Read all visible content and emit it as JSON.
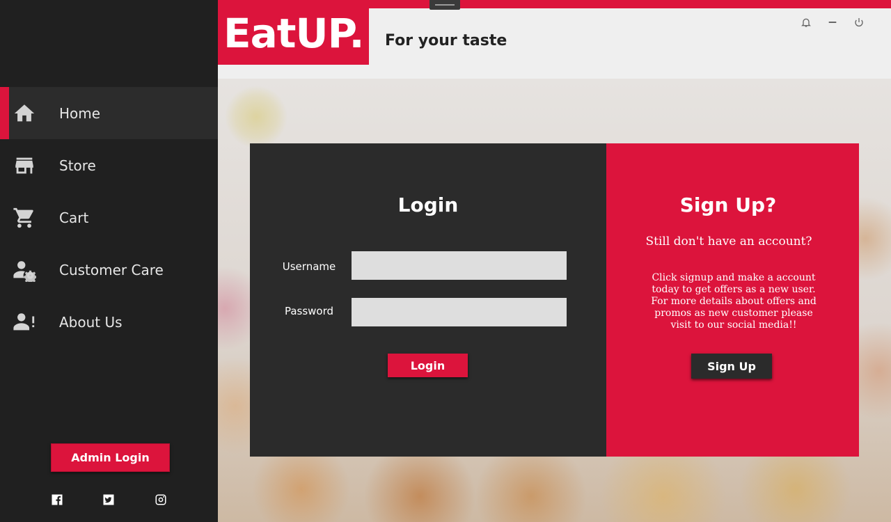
{
  "sidebar": {
    "items": [
      {
        "label": "Home",
        "icon": "home-icon",
        "active": true
      },
      {
        "label": "Store",
        "icon": "store-icon",
        "active": false
      },
      {
        "label": "Cart",
        "icon": "cart-icon",
        "active": false
      },
      {
        "label": "Customer Care",
        "icon": "user-gear-icon",
        "active": false
      },
      {
        "label": "About Us",
        "icon": "user-alert-icon",
        "active": false
      }
    ],
    "admin_login_label": "Admin Login",
    "social": [
      "facebook-icon",
      "twitter-icon",
      "instagram-icon"
    ]
  },
  "header": {
    "logo": "EatUP.",
    "tagline": "For your taste",
    "window_controls": [
      "bell-icon",
      "minimize-icon",
      "power-icon"
    ]
  },
  "login": {
    "title": "Login",
    "username_label": "Username",
    "username_value": "",
    "password_label": "Password",
    "password_value": "",
    "button_label": "Login"
  },
  "signup": {
    "title": "Sign Up?",
    "subtitle": "Still don't have an account?",
    "description": "Click signup and make a account today to get offers as a new user. For more details about offers and promos as new customer please visit to our social media!!",
    "button_label": "Sign Up"
  },
  "colors": {
    "accent": "#dc143c",
    "sidebar_bg": "#202020",
    "panel_dark": "#2b2b2b"
  }
}
